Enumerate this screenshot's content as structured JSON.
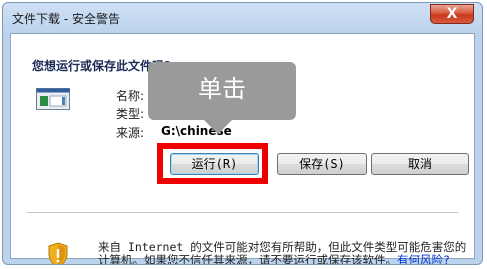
{
  "window": {
    "title": "文件下载 - 安全警告",
    "close_label": "X"
  },
  "question": "您想运行或保存此文件吗?",
  "file": {
    "icon": "executable-file-icon",
    "name_label": "名称:",
    "type_label": "类型:",
    "source_label": "来源:",
    "source_value": "G:\\chinese"
  },
  "buttons": {
    "run": "运行(R)",
    "save": "保存(S)",
    "cancel": "取消"
  },
  "callout": {
    "text": "单击"
  },
  "warning": {
    "icon": "shield-warning-icon",
    "text": "来自 Internet 的文件可能对您有所帮助，但此文件类型可能危害您的计算机。如果您不信任其来源，请不要运行或保存该软件。",
    "link": "有何风险?"
  },
  "colors": {
    "highlight": "#ee0000",
    "callout_bg": "#9a9a9a",
    "link": "#0033cc"
  }
}
